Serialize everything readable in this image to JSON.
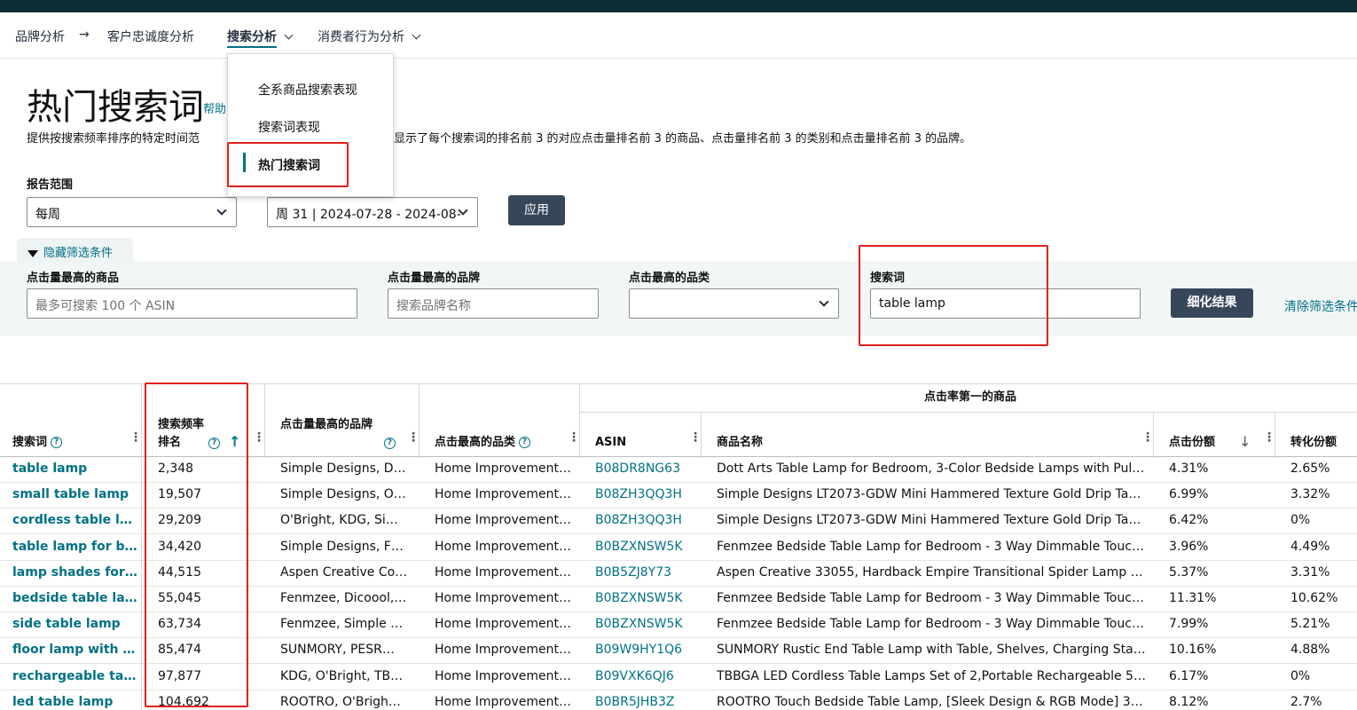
{
  "nav": {
    "breadcrumb_1": "品牌分析",
    "breadcrumb_arrow": "→",
    "breadcrumb_2": "客户忠诚度分析",
    "active_tab": "搜索分析",
    "tab_4": "消费者行为分析"
  },
  "dropdown_menu": {
    "items": [
      "全系商品搜索表现",
      "搜索词表现",
      "热门搜索词"
    ],
    "selected_index": 2
  },
  "header": {
    "title": "热门搜索词",
    "help_link": "帮助",
    "description_left": "提供按搜索频率排序的特定时间范",
    "description_right": "显示了每个搜索词的排名前 3 的对应点击量排名前 3 的商品、点击量排名前 3 的类别和点击量排名前 3 的品牌。"
  },
  "report": {
    "range_label": "报告范围",
    "range_value": "每周",
    "week_value": "周 31 | 2024-07-28 - 2024-08-",
    "apply_button": "应用"
  },
  "filters": {
    "toggle_label": "隐藏筛选条件",
    "top_asin_label": "点击量最高的商品",
    "top_asin_placeholder": "最多可搜索 100 个 ASIN",
    "top_brand_label": "点击量最高的品牌",
    "top_brand_placeholder": "搜索品牌名称",
    "top_category_label": "点击最高的品类",
    "search_term_label": "搜索词",
    "search_term_value": "table lamp",
    "refine_button": "细化结果",
    "clear_link": "清除筛选条件"
  },
  "table": {
    "group_header": "点击率第一的商品",
    "headers": {
      "search_term": "搜索词",
      "rank": "搜索频率排名",
      "brand": "点击量最高的品牌",
      "category": "点击最高的品类",
      "asin": "ASIN",
      "product_name": "商品名称",
      "click_share": "点击份额",
      "conversion_share": "转化份额"
    },
    "rows": [
      {
        "term": "table lamp",
        "rank": "2,348",
        "brand": "Simple Designs, D…",
        "category": "Home Improvement…",
        "asin": "B08DR8NG63",
        "name": "Dott Arts Table Lamp for Bedroom, 3-Color Bedside Lamps with Pull …",
        "click": "4.31%",
        "conv": "2.65%"
      },
      {
        "term": "small table lamp",
        "rank": "19,507",
        "brand": "Simple Designs, O…",
        "category": "Home Improvement…",
        "asin": "B08ZH3QQ3H",
        "name": "Simple Designs LT2073-GDW Mini Hammered Texture Gold Drip Tabl…",
        "click": "6.99%",
        "conv": "3.32%"
      },
      {
        "term": "cordless table lamp",
        "rank": "29,209",
        "brand": "O'Bright, KDG, Si…",
        "category": "Home Improvement…",
        "asin": "B08ZH3QQ3H",
        "name": "Simple Designs LT2073-GDW Mini Hammered Texture Gold Drip Tabl…",
        "click": "6.42%",
        "conv": "0%"
      },
      {
        "term": "table lamp for bedro",
        "rank": "34,420",
        "brand": "Simple Designs, F…",
        "category": "Home Improvement…",
        "asin": "B0BZXNSW5K",
        "name": "Fenmzee Bedside Table Lamp for Bedroom - 3 Way Dimmable Touch …",
        "click": "3.96%",
        "conv": "4.49%"
      },
      {
        "term": "lamp shades for tabl",
        "rank": "44,515",
        "brand": "Aspen Creative Co…",
        "category": "Home Improvement…",
        "asin": "B0B5ZJ8Y73",
        "name": "Aspen Creative 33055, Hardback Empire Transitional Spider Lamp S…",
        "click": "5.37%",
        "conv": "3.31%"
      },
      {
        "term": "bedside table lamp",
        "rank": "55,045",
        "brand": "Fenmzee, Dicoool,…",
        "category": "Home Improvement…",
        "asin": "B0BZXNSW5K",
        "name": "Fenmzee Bedside Table Lamp for Bedroom - 3 Way Dimmable Touch …",
        "click": "11.31%",
        "conv": "10.62%"
      },
      {
        "term": "side table lamp",
        "rank": "63,734",
        "brand": "Fenmzee, Simple …",
        "category": "Home Improvement…",
        "asin": "B0BZXNSW5K",
        "name": "Fenmzee Bedside Table Lamp for Bedroom - 3 Way Dimmable Touch …",
        "click": "7.99%",
        "conv": "5.21%"
      },
      {
        "term": "floor lamp with table",
        "rank": "85,474",
        "brand": "SUNMORY, PESR…",
        "category": "Home Improvement…",
        "asin": "B09W9HY1Q6",
        "name": "SUNMORY Rustic End Table Lamp with Table, Shelves, Charging Sta…",
        "click": "10.16%",
        "conv": "4.88%"
      },
      {
        "term": "rechargeable table la",
        "rank": "97,877",
        "brand": "KDG, O'Bright, TB…",
        "category": "Home Improvement…",
        "asin": "B09VXK6QJ6",
        "name": "TBBGA LED Cordless Table Lamps Set of 2,Portable Rechargeable 5…",
        "click": "6.17%",
        "conv": "0%"
      },
      {
        "term": "led table lamp",
        "rank": "104,692",
        "brand": "ROOTRO, O'Brigh…",
        "category": "Home Improvement…",
        "asin": "B0BR5JHB3Z",
        "name": "ROOTRO Touch Bedside Table Lamp, [Sleek Design & RGB Mode] 3 …",
        "click": "8.12%",
        "conv": "2.7%"
      }
    ]
  },
  "icons": {
    "sort_asc": "arrow-up-icon",
    "sort_desc": "arrow-down-icon",
    "help": "question-circle-icon",
    "filter": "funnel-icon",
    "column_menu": "kebab-icon"
  },
  "colors": {
    "accent": "#007185",
    "annotation": "#e0201a",
    "topbar": "#0f2d36",
    "button_dark": "#37475a"
  }
}
